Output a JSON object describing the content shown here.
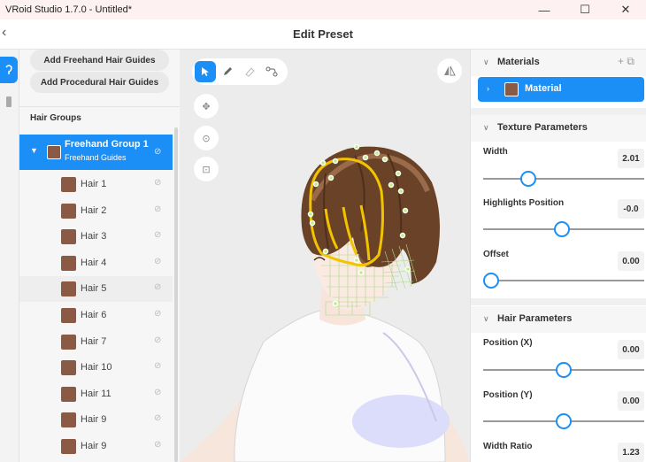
{
  "window": {
    "title": "VRoid Studio 1.7.0 - Untitled*",
    "minimize": "—",
    "maximize": "☐",
    "close": "✕"
  },
  "header": {
    "back": "‹",
    "title": "Edit Preset"
  },
  "left_panel": {
    "add_freehand": "Add Freehand Hair Guides",
    "add_procedural": "Add Procedural Hair Guides",
    "section_title": "Hair Groups",
    "group": {
      "name": "Freehand Group 1",
      "subtitle": "Freehand Guides"
    },
    "hairs": [
      "Hair 1",
      "Hair 2",
      "Hair 3",
      "Hair 4",
      "Hair 5",
      "Hair 6",
      "Hair 7",
      "Hair 10",
      "Hair 11",
      "Hair 9",
      "Hair 9"
    ],
    "highlighted_index": 4
  },
  "right_panel": {
    "materials": {
      "title": "Materials",
      "item": "Material"
    },
    "texture": {
      "title": "Texture Parameters",
      "params": [
        {
          "label": "Width",
          "value": "2.01",
          "pos": 0.28
        },
        {
          "label": "Highlights Position",
          "value": "-0.0",
          "pos": 0.49
        },
        {
          "label": "Offset",
          "value": "0.00",
          "pos": 0.05
        }
      ]
    },
    "hair": {
      "title": "Hair Parameters",
      "params": [
        {
          "label": "Position (X)",
          "value": "0.00",
          "pos": 0.5
        },
        {
          "label": "Position (Y)",
          "value": "0.00",
          "pos": 0.5
        },
        {
          "label": "Width Ratio",
          "value": "1.23"
        }
      ]
    }
  },
  "colors": {
    "accent": "#1b8ff5",
    "hair_swatch": "#8a5a44",
    "guide": "#f2c400"
  }
}
